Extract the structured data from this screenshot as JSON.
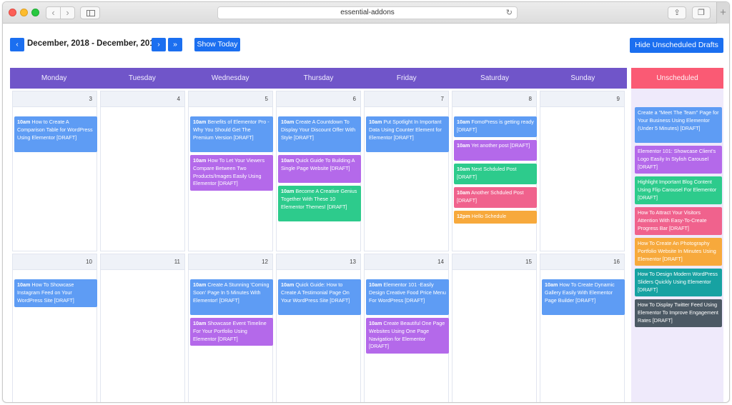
{
  "browser": {
    "url": "essential-addons"
  },
  "toolbar": {
    "prev_label": "‹",
    "range_title": "December, 2018 - December, 2018",
    "next_label": "›",
    "last_label": "»",
    "today_label": "Show Today",
    "drafts_label": "Hide Unscheduled Drafts"
  },
  "colors": {
    "accent_blue": "#1b6ff0",
    "header_purple": "#7055c9",
    "unscheduled_red": "#fa5a74",
    "event_blue": "#5e9cf4",
    "event_purple": "#b469ea",
    "event_green": "#2dcb8c",
    "event_pink": "#f0628d",
    "event_orange": "#f7a93c",
    "event_teal": "#17a2a2",
    "event_slate": "#4c5964"
  },
  "calendar": {
    "days": [
      "Monday",
      "Tuesday",
      "Wednesday",
      "Thursday",
      "Friday",
      "Saturday",
      "Sunday"
    ],
    "weeks": [
      {
        "dates": [
          "3",
          "4",
          "5",
          "6",
          "7",
          "8",
          "9"
        ],
        "events": [
          [
            {
              "time": "10am",
              "title": "How to Create A Comparison Table for WordPress Using Elementor [DRAFT]",
              "color": "blue"
            }
          ],
          [],
          [
            {
              "time": "10am",
              "title": "Benefits of Elementor Pro - Why You Should Get The Premium Version [DRAFT]",
              "color": "blue"
            },
            {
              "time": "10am",
              "title": "How To Let Your Viewers Compare Between Two Products/Images Easily Using Elementor [DRAFT]",
              "color": "purple"
            }
          ],
          [
            {
              "time": "10am",
              "title": "Create A Countdown To Display Your Discount Offer With Style [DRAFT]",
              "color": "blue"
            },
            {
              "time": "10am",
              "title": "Quick Guide To Building A Single Page Website [DRAFT]",
              "color": "purple"
            },
            {
              "time": "10am",
              "title": "Become A Creative Genius Together With These 10 Elementor Themes! [DRAFT]",
              "color": "green"
            }
          ],
          [
            {
              "time": "10am",
              "title": "Put Spotlight In Important Data Using Counter Element for Elementor [DRAFT]",
              "color": "blue"
            }
          ],
          [
            {
              "time": "10am",
              "title": "FomoPress is getting ready [DRAFT]",
              "color": "blue"
            },
            {
              "time": "10am",
              "title": "Yet another post [DRAFT]",
              "color": "purple"
            },
            {
              "time": "10am",
              "title": "Next Schduled Post [DRAFT]",
              "color": "green"
            },
            {
              "time": "10am",
              "title": "Another Schduled Post [DRAFT]",
              "color": "pink"
            },
            {
              "time": "12pm",
              "title": "Hello Schedule",
              "color": "orange"
            }
          ],
          []
        ]
      },
      {
        "dates": [
          "10",
          "11",
          "12",
          "13",
          "14",
          "15",
          "16"
        ],
        "events": [
          [
            {
              "time": "10am",
              "title": "How To Showcase Instagram Feed on Your WordPress Site [DRAFT]",
              "color": "blue"
            }
          ],
          [],
          [
            {
              "time": "10am",
              "title": "Create A Stunning 'Coming Soon' Page In 5 Minutes With Elementor! [DRAFT]",
              "color": "blue"
            },
            {
              "time": "10am",
              "title": "Showcase Event Timeline For Your Portfolio Using Elementor [DRAFT]",
              "color": "purple"
            }
          ],
          [
            {
              "time": "10am",
              "title": "Quick Guide: How to Create A Testimonial Page On Your WordPress Site [DRAFT]",
              "color": "blue"
            }
          ],
          [
            {
              "time": "10am",
              "title": "Elementor 101 -Easily Design Creative Food Price Menu For WordPress [DRAFT]",
              "color": "blue"
            },
            {
              "time": "10am",
              "title": "Create Beautiful One Page Websites Using One Page Navigation for Elementor [DRAFT]",
              "color": "purple"
            }
          ],
          [],
          [
            {
              "time": "10am",
              "title": "How To Create Dynamic Gallery Easily With Elementor Page Builder [DRAFT]",
              "color": "blue"
            }
          ]
        ]
      }
    ]
  },
  "unscheduled": {
    "title": "Unscheduled",
    "items": [
      {
        "title": "Create a \"Meet The Team\" Page for Your Business Using Elementor (Under 5 Minutes) [DRAFT]",
        "color": "blue"
      },
      {
        "title": "Elementor 101: Showcase Client's Logo Easily In Stylish Carousel [DRAFT]",
        "color": "purple"
      },
      {
        "title": "Highlight Important Blog Content Using Flip Carousel For Elementor [DRAFT]",
        "color": "green"
      },
      {
        "title": "How To Attract Your Visitors Attention With Easy-To-Create Progress Bar [DRAFT]",
        "color": "pink"
      },
      {
        "title": "How To Create An Photography Portfolio Website In Minutes Using Elementor [DRAFT]",
        "color": "orange"
      },
      {
        "title": "How To Design Modern WordPress Sliders Quickly Using Elementor [DRAFT]",
        "color": "teal"
      },
      {
        "title": "How To Display Twitter Feed Using Elementor To Improve Engagement Rates [DRAFT]",
        "color": "slate"
      }
    ]
  }
}
